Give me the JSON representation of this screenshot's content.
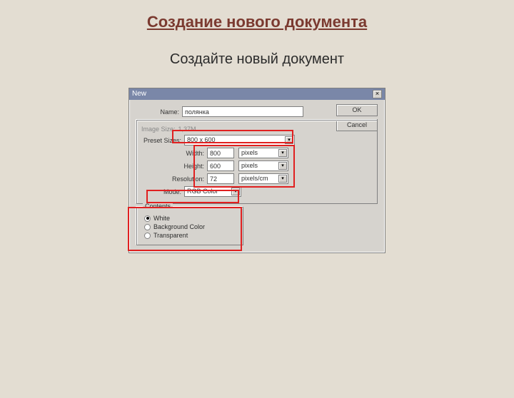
{
  "slide": {
    "title": "Создание нового документа",
    "subtitle": "Создайте новый документ"
  },
  "dialog": {
    "title": "New",
    "close_glyph": "×",
    "ok": "OK",
    "cancel": "Cancel",
    "name": {
      "label": "Name:",
      "value": "полянка"
    },
    "imgsize_label": "Image Size:",
    "imgsize_value": "1,37M",
    "preset": {
      "label": "Preset Sizes:",
      "value": "800 x 600"
    },
    "width": {
      "label": "Width:",
      "value": "800",
      "units": "pixels"
    },
    "height": {
      "label": "Height:",
      "value": "600",
      "units": "pixels"
    },
    "resolution": {
      "label": "Resolution:",
      "value": "72",
      "units": "pixels/cm"
    },
    "mode": {
      "label": "Mode:",
      "value": "RGB Color"
    },
    "contents": {
      "title": "Contents",
      "white": "White",
      "bgcolor": "Background Color",
      "transparent": "Transparent"
    },
    "arrow": "▾"
  }
}
